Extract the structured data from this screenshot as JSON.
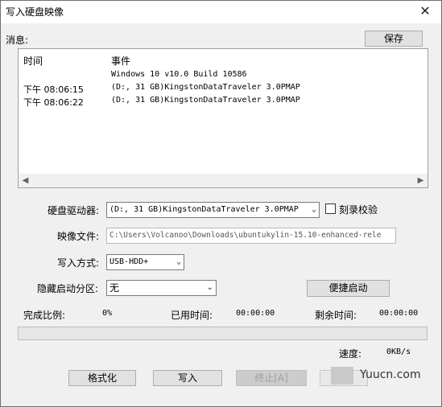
{
  "window": {
    "title": "写入硬盘映像",
    "close_glyph": "✕"
  },
  "log": {
    "section_label": "消息:",
    "save_button": "保存",
    "col_time": "时间",
    "col_event": "事件",
    "rows": [
      {
        "time": "",
        "event": "Windows 10 v10.0 Build 10586"
      },
      {
        "time": "下午 08:06:15",
        "event": "(D:, 31 GB)KingstonDataTraveler 3.0PMAP"
      },
      {
        "time": "下午 08:06:22",
        "event": "(D:, 31 GB)KingstonDataTraveler 3.0PMAP"
      }
    ]
  },
  "form": {
    "drive_label": "硬盘驱动器:",
    "drive_value": "(D:, 31 GB)KingstonDataTraveler 3.0PMAP",
    "verify_label": "刻录校验",
    "verify_checked": false,
    "image_label": "映像文件:",
    "image_value": "C:\\Users\\Volcanoo\\Downloads\\ubuntukylin-15.10-enhanced-rele",
    "method_label": "写入方式:",
    "method_value": "USB-HDD+",
    "hidden_label": "隐藏启动分区:",
    "hidden_value": "无",
    "quick_boot_button": "便捷启动"
  },
  "status": {
    "done_label": "完成比例:",
    "done_value": "0%",
    "progress_fraction": 0,
    "elapsed_label": "已用时间:",
    "elapsed_value": "00:00:00",
    "remaining_label": "剩余时间:",
    "remaining_value": "00:00:00",
    "speed_label": "速度:",
    "speed_value": "0KB/s"
  },
  "actions": {
    "format_button": "格式化",
    "write_button": "写入",
    "abort_button": "终止[A]"
  },
  "watermark": {
    "text": "Yuucn.com"
  },
  "colors": {
    "progress_fill": "#06b025",
    "window_bg": "#f0f0f0"
  }
}
